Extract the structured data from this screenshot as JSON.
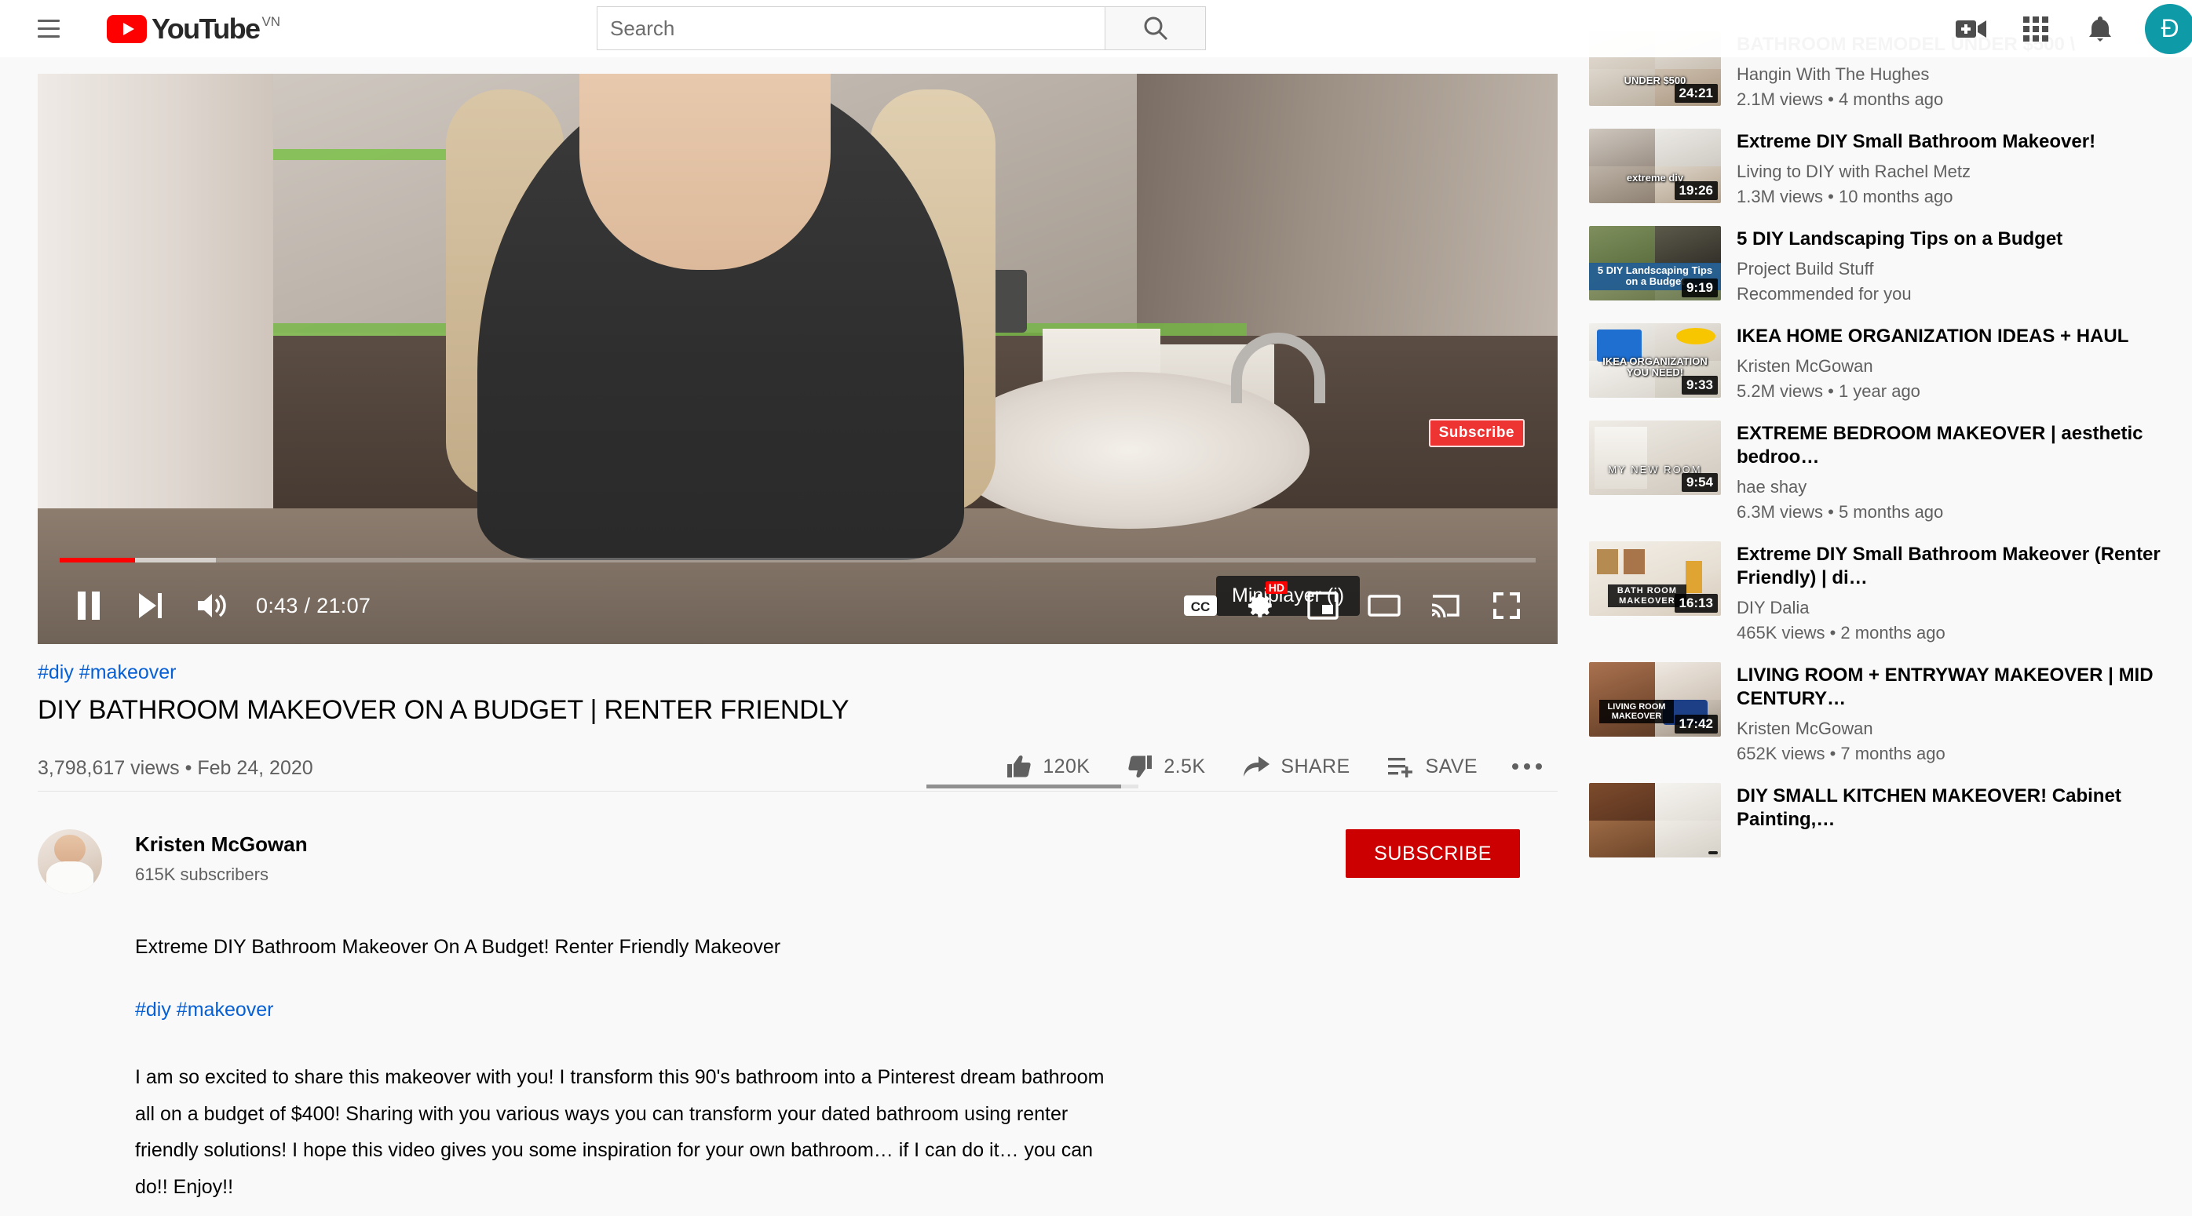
{
  "header": {
    "menu_icon": "hamburger-menu-icon",
    "logo_text": "YouTube",
    "logo_country": "VN",
    "search_placeholder": "Search",
    "search_value": "",
    "search_icon": "search-icon",
    "create_icon": "video-camera-plus-icon",
    "apps_icon": "apps-grid-icon",
    "notifications_icon": "bell-icon",
    "avatar_letter": "Đ"
  },
  "player": {
    "current_time": "0:43",
    "total_time": "21:07",
    "time_display": "0:43 / 21:07",
    "progress_played_pct": 5.1,
    "progress_buffered_pct": 10.6,
    "tooltip": "Miniplayer (i)",
    "watermark": "Subscribe",
    "quality_badge": "HD",
    "controls": {
      "pause": "pause-icon",
      "next": "next-video-icon",
      "volume": "volume-icon",
      "captions": "closed-captions-icon",
      "settings": "settings-gear-icon",
      "miniplayer": "miniplayer-icon",
      "theater": "theater-mode-icon",
      "cast": "cast-icon",
      "fullscreen": "fullscreen-icon"
    }
  },
  "video": {
    "hashtags": "#diy #makeover",
    "title": "DIY BATHROOM MAKEOVER ON A BUDGET | RENTER FRIENDLY",
    "views": "3,798,617 views",
    "separator": "•",
    "date": "Feb 24, 2020",
    "views_line": "3,798,617 views • Feb 24, 2020",
    "likes": "120K",
    "dislikes": "2.5K",
    "share_label": "SHARE",
    "save_label": "SAVE",
    "like_ratio_pct": 92
  },
  "channel": {
    "name": "Kristen McGowan",
    "subscribers": "615K subscribers",
    "subscribe_label": "SUBSCRIBE"
  },
  "description": {
    "line1": "Extreme DIY Bathroom Makeover On A Budget! Renter Friendly Makeover",
    "tags": "#diy #makeover",
    "body": "I am so excited to share this makeover with you! I transform this 90's bathroom into a Pinterest dream bathroom all on a budget of $400! Sharing with you various ways you can transform your dated bathroom using renter friendly solutions! I hope this video gives you some inspiration for your own bathroom… if I can do it… you can do!! Enjoy!!"
  },
  "recommendations": [
    {
      "title": "BATHROOM REMODEL UNDER $500 \\",
      "channel": "Hangin With The Hughes",
      "meta": "2.1M views • 4 months ago",
      "duration": "24:21",
      "caption": "UNDER $500"
    },
    {
      "title": "Extreme DIY Small Bathroom Makeover!",
      "channel": "Living to DIY with Rachel Metz",
      "meta": "1.3M views • 10 months ago",
      "duration": "19:26",
      "caption": "extreme diy"
    },
    {
      "title": "5 DIY Landscaping Tips on a Budget",
      "channel": "Project Build Stuff",
      "meta": "Recommended for you",
      "duration": "9:19",
      "caption": "5 DIY Landscaping Tips on a Budget"
    },
    {
      "title": "IKEA HOME ORGANIZATION IDEAS + HAUL",
      "channel": "Kristen McGowan",
      "meta": "5.2M views • 1 year ago",
      "duration": "9:33",
      "caption": "IKEA ORGANIZATION YOU NEED!"
    },
    {
      "title": "EXTREME BEDROOM MAKEOVER | aesthetic bedroo…",
      "channel": "hae shay",
      "meta": "6.3M views • 5 months ago",
      "duration": "9:54",
      "caption": "MY NEW ROOM"
    },
    {
      "title": "Extreme DIY Small Bathroom Makeover (Renter Friendly) | di…",
      "channel": "DIY Dalia",
      "meta": "465K views • 2 months ago",
      "duration": "16:13",
      "caption": "BATH ROOM MAKEOVER"
    },
    {
      "title": "LIVING ROOM + ENTRYWAY MAKEOVER | MID CENTURY…",
      "channel": "Kristen McGowan",
      "meta": "652K views • 7 months ago",
      "duration": "17:42",
      "caption": "LIVING ROOM MAKEOVER"
    },
    {
      "title": "DIY SMALL KITCHEN MAKEOVER! Cabinet Painting,…",
      "channel": "",
      "meta": "",
      "duration": "",
      "caption": ""
    }
  ],
  "colors": {
    "brand_red": "#ff0000",
    "subscribe_red": "#cc0000",
    "link_blue": "#065fd4",
    "page_bg": "#f9f9f9",
    "avatar_teal": "#0f9aa8"
  }
}
